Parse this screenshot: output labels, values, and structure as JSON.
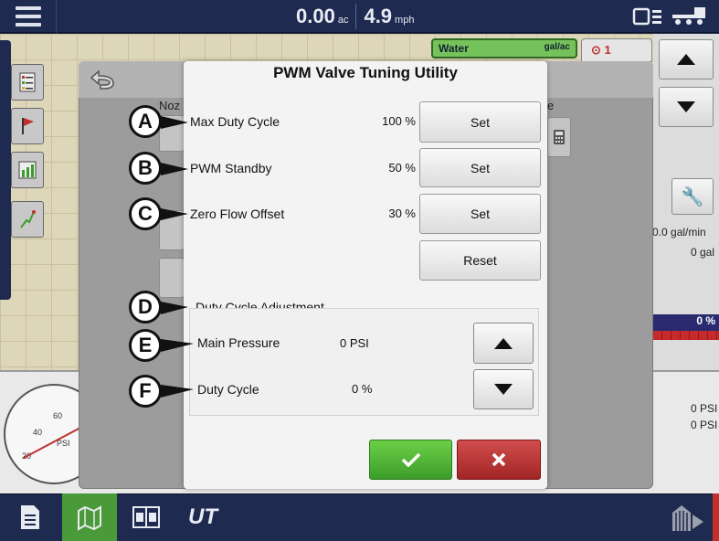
{
  "topbar": {
    "area_value": "0.00",
    "area_unit": "ac",
    "speed_value": "4.9",
    "speed_unit": "mph"
  },
  "map_overlay": {
    "product": "Water",
    "product_unit": "gal/ac",
    "alert_count": "1",
    "flow_rate": "0.0 gal/min",
    "volume": "0 gal",
    "rate_percent": "0 %",
    "pressure_1": "0 PSI",
    "pressure_2": "0 PSI",
    "gauge_labels": [
      "60",
      "40",
      "20",
      "PSI"
    ]
  },
  "background_dialog": {
    "fragment_left": "Noz",
    "fragment_right": "e"
  },
  "dialog": {
    "title": "PWM Valve Tuning Utility",
    "rows": [
      {
        "callout": "A",
        "label": "Max Duty Cycle",
        "value": "100 %",
        "button": "Set"
      },
      {
        "callout": "B",
        "label": "PWM Standby",
        "value": "50 %",
        "button": "Set"
      },
      {
        "callout": "C",
        "label": "Zero Flow Offset",
        "value": "30 %",
        "button": "Set"
      }
    ],
    "reset_label": "Reset",
    "adjustment": {
      "callout": "D",
      "heading": "Duty Cycle Adjustment",
      "main_pressure": {
        "callout": "E",
        "label": "Main Pressure",
        "value": "0 PSI"
      },
      "duty_cycle": {
        "callout": "F",
        "label": "Duty Cycle",
        "value": "0 %"
      }
    }
  },
  "colors": {
    "ok_button": "#4aae32",
    "cancel_button": "#b83232",
    "bar_background": "#1f2a50"
  },
  "bottombar": {
    "ut_label": "UT"
  }
}
